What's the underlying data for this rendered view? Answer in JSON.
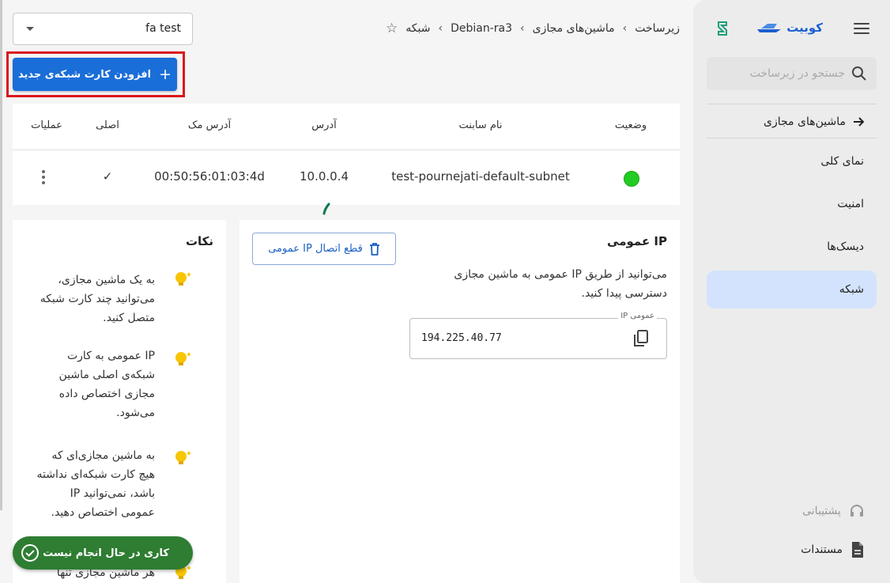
{
  "sidebar": {
    "brand": "کوبیت",
    "search_placeholder": "جستجو در زیرساخت",
    "back_label": "ماشین‌های مجازی",
    "items": [
      {
        "label": "نمای کلی",
        "active": false
      },
      {
        "label": "امنیت",
        "active": false
      },
      {
        "label": "دیسک‌ها",
        "active": false
      },
      {
        "label": "شبکه",
        "active": true
      }
    ],
    "support_label": "پشتیبانی",
    "docs_label": "مستندات"
  },
  "breadcrumb": [
    "زیرساخت",
    "ماشین‌های مجازی",
    "Debian-ra3",
    "شبکه"
  ],
  "project_select": {
    "value": "fa test"
  },
  "add_button": {
    "label": "افزودن کارت شبکه‌ی جدید"
  },
  "table": {
    "headers": {
      "status": "وضعیت",
      "subnet": "نام سابنت",
      "address": "آدرس",
      "mac": "آدرس مک",
      "primary": "اصلی",
      "actions": "عملیات"
    },
    "rows": [
      {
        "status_color": "#22cc22",
        "subnet": "test-pournejati-default-subnet",
        "address": "10.0.0.4",
        "mac": "00:50:56:01:03:4d",
        "primary": "✓"
      }
    ]
  },
  "public_ip": {
    "title": "IP عمومی",
    "description": "می‌توانید از طریق IP عمومی به ماشین مجازی دسترسی پیدا کنید.",
    "disconnect_label": "قطع اتصال IP عمومی",
    "field_label": "IP عمومی",
    "value": "194.225.40.77"
  },
  "notes": {
    "title": "نکات",
    "items": [
      "به یک ماشین مجازی، می‌توانید چند کارت شبکه متصل کنید.",
      "IP عمومی به کارت شبکه‌ی اصلی ماشین مجازی اختصاص داده می‌شود.",
      "به ماشین مجازی‌ای که هیچ کارت شبکه‌ای نداشته باشد، نمی‌توانید IP عمومی اختصاص دهید.",
      "هر ماشین مجازی تنها"
    ]
  },
  "toast": {
    "label": "کاری در حال انجام نیست"
  },
  "colors": {
    "primary": "#1a6ed8",
    "highlight": "#d9161b",
    "active_nav": "#d3e3fd",
    "status_ok": "#22cc22",
    "toast": "#2e7d32"
  }
}
